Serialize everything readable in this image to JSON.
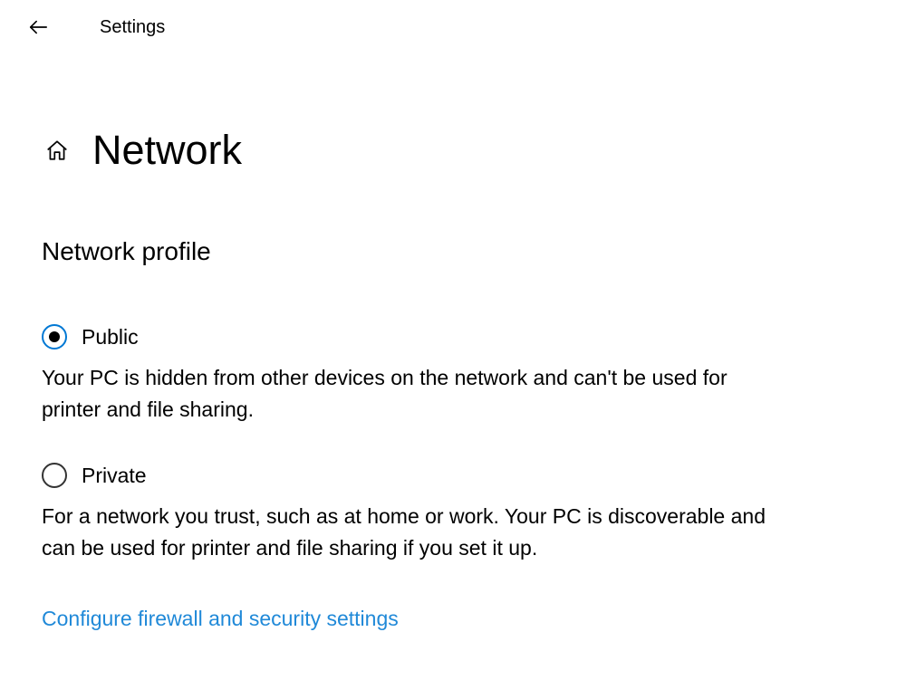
{
  "header": {
    "app_title": "Settings"
  },
  "page": {
    "title": "Network"
  },
  "section": {
    "heading": "Network profile"
  },
  "options": {
    "public": {
      "label": "Public",
      "description": "Your PC is hidden from other devices on the network and can't be used for printer and file sharing.",
      "selected": true
    },
    "private": {
      "label": "Private",
      "description": "For a network you trust, such as at home or work. Your PC is discoverable and can be used for printer and file sharing if you set it up.",
      "selected": false
    }
  },
  "link": {
    "firewall": "Configure firewall and security settings"
  }
}
